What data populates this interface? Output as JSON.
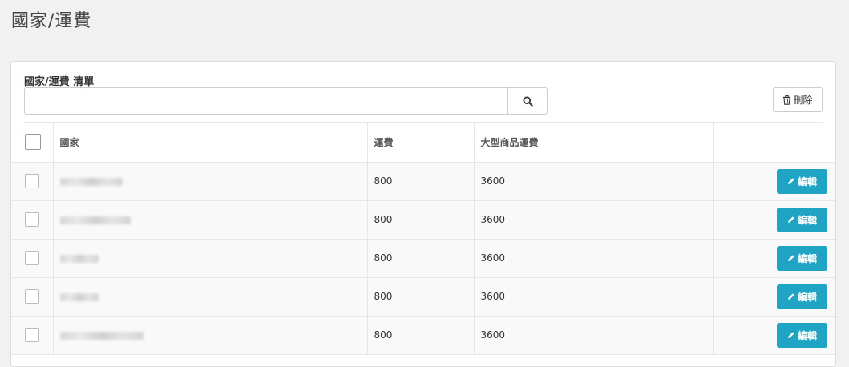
{
  "page": {
    "title": "國家/運費"
  },
  "panel": {
    "heading": "國家/運費 清單",
    "search": {
      "value": "",
      "placeholder": "",
      "icon": "search-icon"
    },
    "delete_button": {
      "label": "刪除",
      "icon": "trash-icon"
    }
  },
  "table": {
    "headers": {
      "country": "國家",
      "fee": "運費",
      "large_fee": "大型商品運費"
    },
    "rows": [
      {
        "fee": "800",
        "large_fee": "3600",
        "edit_label": "編輯"
      },
      {
        "fee": "800",
        "large_fee": "3600",
        "edit_label": "編輯"
      },
      {
        "fee": "800",
        "large_fee": "3600",
        "edit_label": "編輯"
      },
      {
        "fee": "800",
        "large_fee": "3600",
        "edit_label": "編輯"
      },
      {
        "fee": "800",
        "large_fee": "3600",
        "edit_label": "編輯"
      }
    ]
  },
  "colors": {
    "accent": "#20a4c4",
    "background": "#f1f1f1"
  }
}
